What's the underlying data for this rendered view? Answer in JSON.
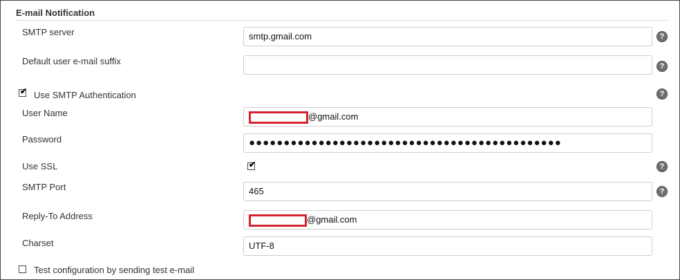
{
  "section_title": "E-mail Notification",
  "fields": {
    "smtp_server": {
      "label": "SMTP server",
      "value": "smtp.gmail.com"
    },
    "email_suffix": {
      "label": "Default user e-mail suffix",
      "value": ""
    },
    "use_smtp_auth": {
      "label": "Use SMTP Authentication",
      "checked": true
    },
    "user_name": {
      "label": "User Name",
      "value_suffix": "@gmail.com"
    },
    "password": {
      "label": "Password",
      "value": "●●●●●●●●●●●●●●●●●●●●●●●●●●●●●●●●●●●●●●●●●●●●●"
    },
    "use_ssl": {
      "label": "Use SSL",
      "checked": true
    },
    "smtp_port": {
      "label": "SMTP Port",
      "value": "465"
    },
    "reply_to": {
      "label": "Reply-To Address",
      "value_suffix": "@gmail.com"
    },
    "charset": {
      "label": "Charset",
      "value": "UTF-8"
    },
    "test_config": {
      "label": "Test configuration by sending test e-mail",
      "checked": false
    }
  },
  "help_icon": "?",
  "icons": {
    "help": "help-icon",
    "checkbox": "checkbox"
  }
}
